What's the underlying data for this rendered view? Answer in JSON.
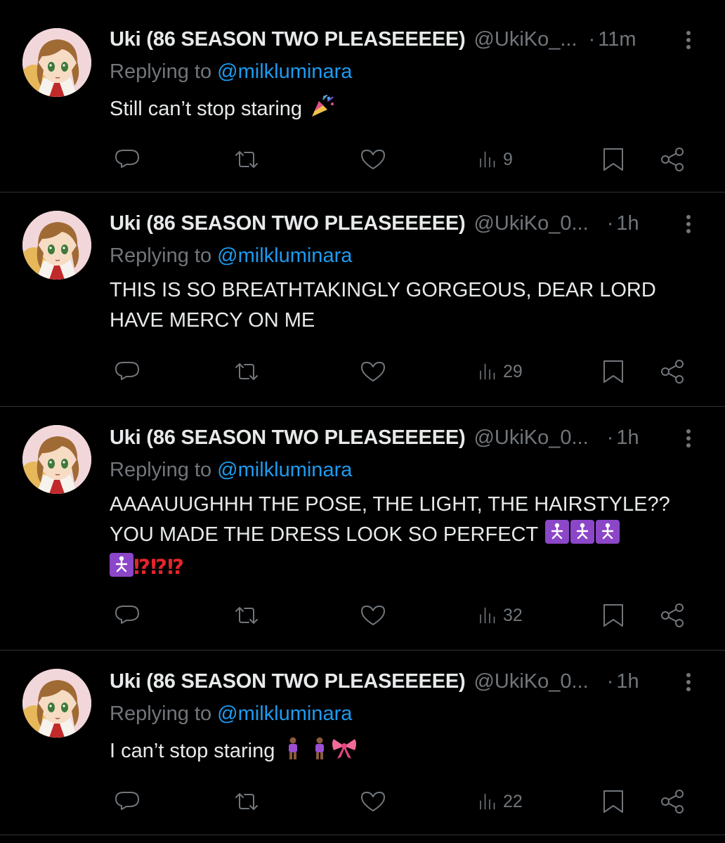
{
  "tweets": [
    {
      "name": "Uki (86 SEASON TWO PLEASEEEEE)",
      "handle": "@UkiKo_...",
      "dot": "·",
      "time": "11m",
      "replying_prefix": "Replying to ",
      "replying_handle": "@milkluminara",
      "text": "Still can’t stop staring",
      "emoji": [
        "party-popper"
      ],
      "views": "9"
    },
    {
      "name": "Uki (86 SEASON TWO PLEASEEEEE)",
      "handle": "@UkiKo_0...",
      "dot": "·",
      "time": "1h",
      "replying_prefix": "Replying to ",
      "replying_handle": "@milkluminara",
      "text": "THIS IS SO BREATHTAKINGLY GORGEOUS, DEAR LORD HAVE MERCY ON ME",
      "emoji": [],
      "views": "29"
    },
    {
      "name": "Uki (86 SEASON TWO PLEASEEEEE)",
      "handle": "@UkiKo_0...",
      "dot": "·",
      "time": "1h",
      "replying_prefix": "Replying to ",
      "replying_handle": "@milkluminara",
      "text": "AAAAUUGHHH THE POSE, THE LIGHT, THE HAIRSTYLE?? YOU MADE THE DRESS LOOK SO PERFECT",
      "emoji": [
        "kneeling-person-box",
        "kneeling-person-box",
        "kneeling-person-box"
      ],
      "text_line3_emoji": [
        "kneeling-person-box"
      ],
      "exclaim": "⁉⁉⁉",
      "views": "32"
    },
    {
      "name": "Uki (86 SEASON TWO PLEASEEEEE)",
      "handle": "@UkiKo_0...",
      "dot": "·",
      "time": "1h",
      "replying_prefix": "Replying to ",
      "replying_handle": "@milkluminara",
      "text": "I can’t stop staring",
      "emoji": [
        "standing-person",
        "standing-person",
        "ribbon"
      ],
      "views": "22"
    }
  ],
  "icons": {
    "reply": "reply-icon",
    "retweet": "retweet-icon",
    "like": "heart-icon",
    "views": "views-chart-icon",
    "bookmark": "bookmark-icon",
    "share": "share-icon",
    "more": "more-vertical-icon"
  },
  "colors": {
    "background": "#000000",
    "text_primary": "#e7e9ea",
    "text_secondary": "#71767b",
    "link": "#1d9bf0",
    "divider": "#2f3336",
    "exclaim": "#e3242b",
    "emoji_box": "#8c46c8"
  }
}
